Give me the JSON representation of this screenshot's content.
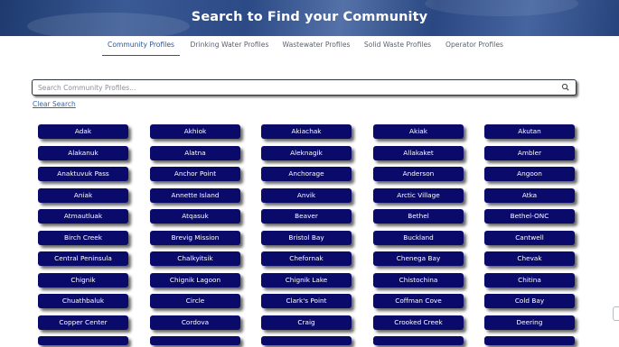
{
  "banner": {
    "title": "Search to Find your Community"
  },
  "tabs": [
    {
      "label": "Community Profiles",
      "active": true
    },
    {
      "label": "Drinking Water Profiles",
      "active": false
    },
    {
      "label": "Wastewater Profiles",
      "active": false
    },
    {
      "label": "Solid Waste Profiles",
      "active": false
    },
    {
      "label": "Operator Profiles",
      "active": false
    }
  ],
  "search": {
    "placeholder": "Search Community Profiles...",
    "value": ""
  },
  "clear_link": "Clear Search",
  "communities": [
    "Adak",
    "Akhiok",
    "Akiachak",
    "Akiak",
    "Akutan",
    "Alakanuk",
    "Alatna",
    "Aleknagik",
    "Allakaket",
    "Ambler",
    "Anaktuvuk Pass",
    "Anchor Point",
    "Anchorage",
    "Anderson",
    "Angoon",
    "Aniak",
    "Annette Island",
    "Anvik",
    "Arctic Village",
    "Atka",
    "Atmautluak",
    "Atqasuk",
    "Beaver",
    "Bethel",
    "Bethel-ONC",
    "Birch Creek",
    "Brevig Mission",
    "Bristol Bay",
    "Buckland",
    "Cantwell",
    "Central Peninsula",
    "Chalkyitsik",
    "Chefornak",
    "Chenega Bay",
    "Chevak",
    "Chignik",
    "Chignik Lagoon",
    "Chignik Lake",
    "Chistochina",
    "Chitina",
    "Chuathbaluk",
    "Circle",
    "Clark's Point",
    "Coffman Cove",
    "Cold Bay",
    "Copper Center",
    "Cordova",
    "Craig",
    "Crooked Creek",
    "Deering"
  ],
  "colors": {
    "button_bg": "#0a0a6b",
    "accent": "#2a5598",
    "link": "#3b66a8"
  }
}
